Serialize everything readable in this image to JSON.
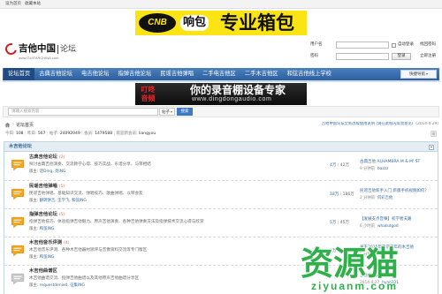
{
  "topbar": {
    "set_home": "设为首页",
    "bookmark": "收藏本站"
  },
  "ad_top": {
    "logo_text": "CNB",
    "brand": "响包",
    "slogan": "专业箱包",
    "background": "#fbe414"
  },
  "logo": {
    "title": "吉他中国",
    "subtitle": "论坛",
    "url": "www.GUITARCHINA.com",
    "accent": "#d7191c"
  },
  "login": {
    "username_label": "用户名",
    "username_value": "",
    "password_label": "密码",
    "password_value": "",
    "remember_label": "自动登录",
    "remember_checked": false,
    "forgot_label": "找回密码",
    "submit_label": "登录",
    "register_label": "立即注册"
  },
  "nav": {
    "items": [
      "论坛首页",
      "古典吉他论坛",
      "电吉他论坛",
      "指弹吉他论坛",
      "民谣吉他弹唱",
      "二手电吉他区",
      "二手木吉他区",
      "和弦吉他线上学校"
    ],
    "active_index": 0,
    "quick_nav_label": "快捷导航",
    "background": "#3a70b2"
  },
  "ad_mid": {
    "logo_text": "叮咚音频",
    "headline": "你的录音棚设备专家",
    "url": "www.dingdongaudio.com"
  },
  "search": {
    "placeholder": "请输入搜索内容",
    "value": "",
    "scope": "帖子",
    "button_label": "搜索"
  },
  "breadcrumb": {
    "separator": "›",
    "current": "论坛首页"
  },
  "notice": {
    "text": "吉他中国论坛全新改版使用说明 (请在此帖内反馈意见)",
    "date": "(2014-4-29)"
  },
  "stats": [
    {
      "label": "今日",
      "value": "108"
    },
    {
      "label": "昨日",
      "value": "567"
    },
    {
      "label": "帖子",
      "value": "24092049"
    },
    {
      "label": "会员",
      "value": "1479588"
    },
    {
      "label": "欢迎新会员",
      "value": "liangyou"
    }
  ],
  "category": {
    "title": "木吉他论坛",
    "moderators_label": "版主:",
    "icon_new_color": "#f3a51c",
    "icon_old_color": "#c9c9c9",
    "forums": [
      {
        "name": "古典吉他论坛",
        "today": "(2)",
        "description": "探讨古典吉他演奏、交流教学心得、技巧实战、乐谱分享、与琴相结",
        "moderators": [
          "话Ding",
          "亮ING"
        ],
        "threads": "4万",
        "posts": "42万",
        "last_post_title": "古典吉他 ALHAMBRA M & M' ST",
        "last_post_time": "9 分钟前",
        "last_post_user": "bazzz",
        "has_new": true
      },
      {
        "name": "民谣吉他弹唱",
        "today": "(5)",
        "description": "民谣吉他弹唱、基础知识交流、弹唱技巧、歌曲弹唱、以琴会友",
        "moderators": [
          "翻转饼吉",
          "王学飞",
          "和弦ING"
        ],
        "threads": "18万",
        "posts": "186万",
        "last_post_title": "民谣吉他新手入门 新版手机视频如何?",
        "last_post_time": "2 分钟前",
        "last_post_user": "何彩吉他",
        "has_new": true
      },
      {
        "name": "指弹吉他论坛",
        "today": "(5)",
        "description": "指弹吉他技巧、体验指弹吉他魅力、原声吉他演奏、各种吉他弹奏方法及指弹技术交流心得与欣赏",
        "moderators": [
          "和弦ING"
        ],
        "threads": "5万",
        "posts": "45万",
        "last_post_title": "【发展支点音樂】初学者天路",
        "last_post_time": "6 小时前",
        "last_post_user": "whatsdgod",
        "has_new": true
      },
      {
        "name": "木吉他音乐评测",
        "today": "(4)",
        "description": "木吉他音乐评测、各种木吉他器材测评与音像资料交流等专门版区",
        "moderators": [
          "和弦ING"
        ],
        "threads": "4万",
        "posts": "34万",
        "last_post_title": "关于2015年南京那年的木吉他",
        "last_post_time": "5 分钟前",
        "last_post_user": "贾乐",
        "has_new": true
      },
      {
        "name": "木吉他曲谱区",
        "today": "",
        "description": "木吉他曲谱交流、指弹吉他曲谱以及其他原声吉他曲谱分享区",
        "moderators": [
          "requestdenied",
          "征集ING"
        ],
        "threads": "",
        "posts": "",
        "last_post_title": "吉他曲谱分享",
        "last_post_time": "2014-4-27",
        "last_post_user": "hyan321",
        "has_new": false
      }
    ]
  },
  "watermark": {
    "cn": "资源猫",
    "en": "ziyuanm.com",
    "color": "#2fb04a"
  }
}
